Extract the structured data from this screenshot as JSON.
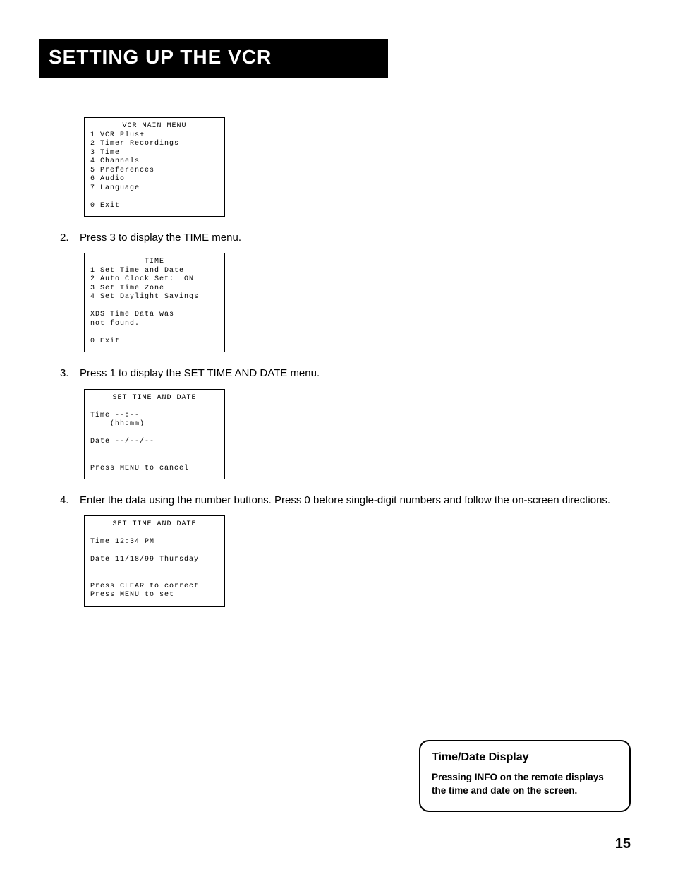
{
  "header_title": "Setting Up the VCR",
  "screen1": {
    "title": "VCR MAIN MENU",
    "l1": "1 VCR Plus+",
    "l2": "2 Timer Recordings",
    "l3": "3 Time",
    "l4": "4 Channels",
    "l5": "5 Preferences",
    "l6": "6 Audio",
    "l7": "7 Language",
    "exit": "0 Exit"
  },
  "step2": {
    "num": "2.",
    "text": "Press 3 to display the TIME menu."
  },
  "screen2": {
    "title": "TIME",
    "l1": "1 Set Time and Date",
    "l2": "2 Auto Clock Set:  ON",
    "l3": "3 Set Time Zone",
    "l4": "4 Set Daylight Savings",
    "m1": "XDS Time Data was",
    "m2": "not found.",
    "exit": "0 Exit"
  },
  "step3": {
    "num": "3.",
    "text": "Press 1 to display the SET TIME AND DATE menu."
  },
  "screen3": {
    "title": "SET TIME AND DATE",
    "l1": "Time --:--",
    "l2": "    (hh:mm)",
    "l3": "Date --/--/--",
    "m1": "Press MENU to cancel"
  },
  "step4": {
    "num": "4.",
    "text": "Enter the data using the number buttons. Press 0 before single-digit numbers and follow the on-screen directions."
  },
  "screen4": {
    "title": "SET TIME AND DATE",
    "l1": "Time 12:34 PM",
    "l2": "Date 11/18/99 Thursday",
    "m1": "Press CLEAR to correct",
    "m2": "Press MENU to set"
  },
  "callout": {
    "title": "Time/Date Display",
    "body": "Pressing INFO on the remote displays the time and date on the screen."
  },
  "page_number": "15"
}
